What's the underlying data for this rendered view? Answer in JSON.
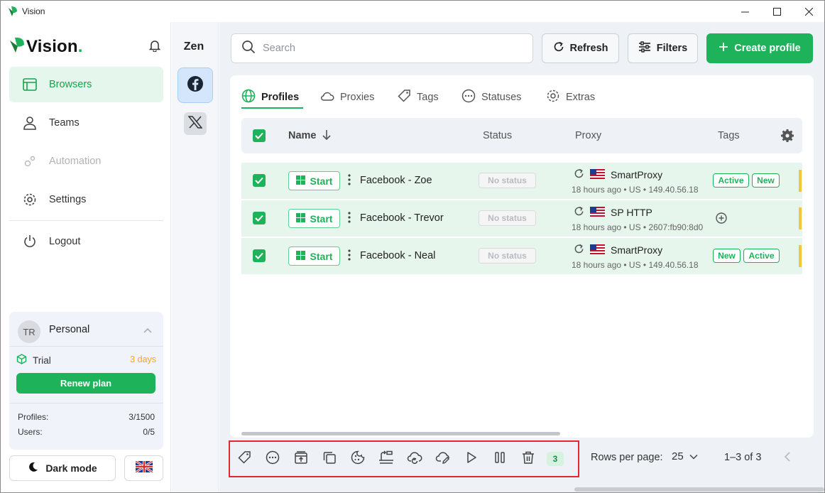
{
  "window": {
    "title": "Vision"
  },
  "brand": {
    "name": "Vision",
    "dot": "."
  },
  "sidebar": {
    "items": [
      {
        "label": "Browsers",
        "icon": "browser-icon",
        "active": true
      },
      {
        "label": "Teams",
        "icon": "person-icon"
      },
      {
        "label": "Automation",
        "icon": "gears-icon",
        "disabled": true
      },
      {
        "label": "Settings",
        "icon": "gear-icon"
      },
      {
        "label": "Logout",
        "icon": "power-icon"
      }
    ],
    "plan": {
      "initials": "TR",
      "workspace": "Personal",
      "plan_name": "Trial",
      "remaining": "3 days",
      "renew_label": "Renew plan",
      "profiles_label": "Profiles:",
      "profiles_value": "3/1500",
      "users_label": "Users:",
      "users_value": "0/5"
    },
    "dark_mode_label": "Dark mode"
  },
  "folders": {
    "title": "Zen"
  },
  "toolbar": {
    "search_placeholder": "Search",
    "refresh_label": "Refresh",
    "filters_label": "Filters",
    "create_label": "Create profile"
  },
  "tabs": [
    {
      "label": "Profiles",
      "active": true
    },
    {
      "label": "Proxies"
    },
    {
      "label": "Tags"
    },
    {
      "label": "Statuses"
    },
    {
      "label": "Extras"
    }
  ],
  "table": {
    "columns": {
      "name": "Name",
      "status": "Status",
      "proxy": "Proxy",
      "tags": "Tags"
    },
    "start_label": "Start",
    "rows": [
      {
        "name": "Facebook - Zoe",
        "status": "No status",
        "proxy_name": "SmartProxy",
        "proxy_info": "18 hours ago • US • 149.40.56.18",
        "tags": [
          "Active",
          "New"
        ]
      },
      {
        "name": "Facebook - Trevor",
        "status": "No status",
        "proxy_name": "SP HTTP",
        "proxy_info": "18 hours ago • US • 2607:fb90:8d0",
        "tags": []
      },
      {
        "name": "Facebook - Neal",
        "status": "No status",
        "proxy_name": "SmartProxy",
        "proxy_info": "18 hours ago • US • 149.40.56.18",
        "tags": [
          "New",
          "Active"
        ]
      }
    ]
  },
  "bulk": {
    "selected_count": "3"
  },
  "pagination": {
    "rows_per_page_label": "Rows per page:",
    "rows_per_page": "25",
    "range": "1–3 of 3"
  },
  "colors": {
    "accent": "#1eb35a",
    "highlight_border": "#e0282e",
    "warning": "#f0a71e"
  }
}
